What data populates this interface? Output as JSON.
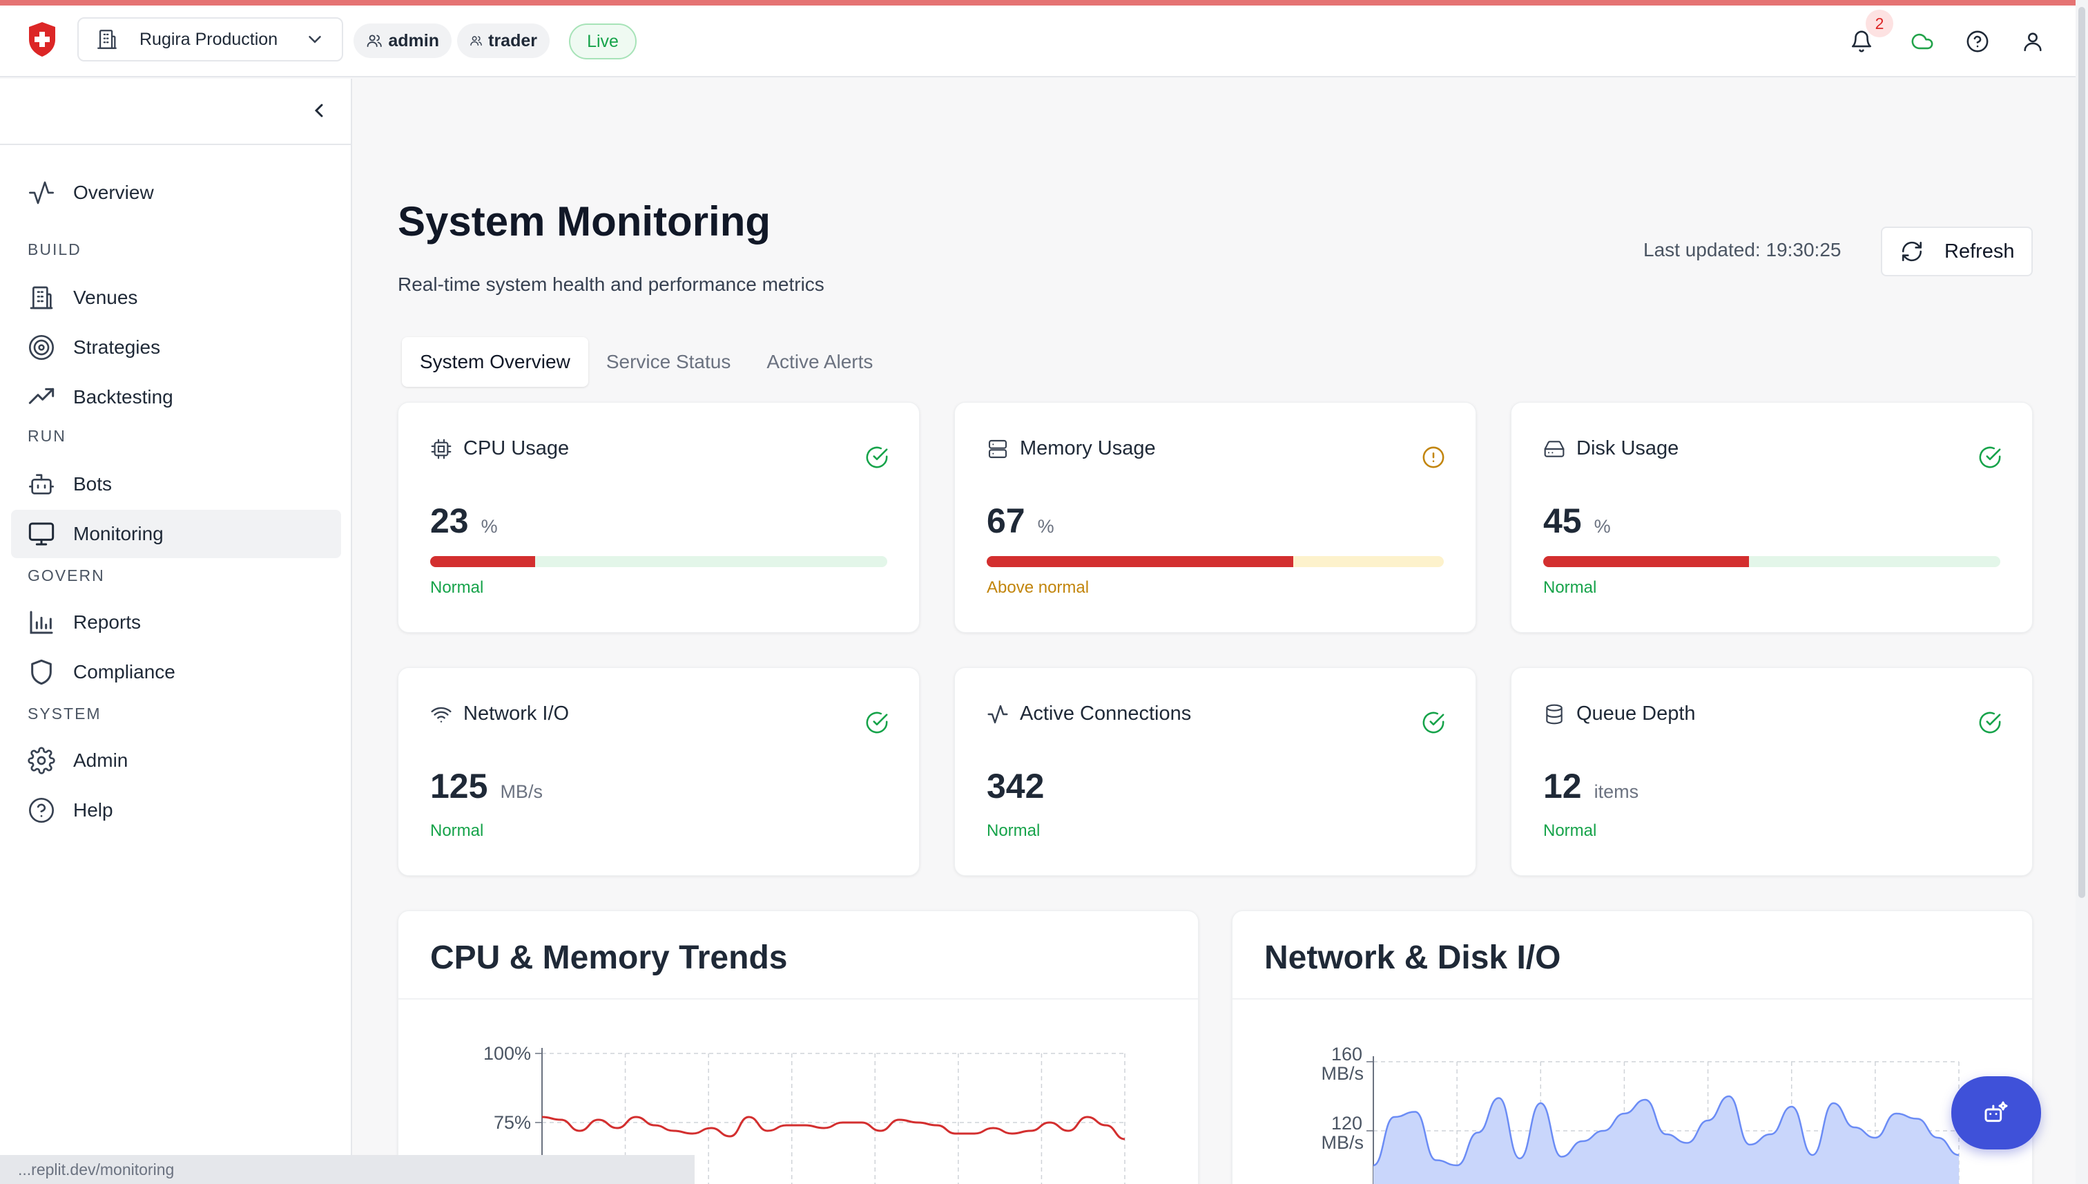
{
  "topbar": {
    "org_name": "Rugira Production",
    "roles": [
      "admin",
      "trader"
    ],
    "live_label": "Live",
    "notification_count": "2",
    "accent_color": "#e57373"
  },
  "sidebar": {
    "overview": "Overview",
    "sections": {
      "build": "BUILD",
      "run": "RUN",
      "govern": "GOVERN",
      "system": "SYSTEM"
    },
    "items": {
      "venues": "Venues",
      "strategies": "Strategies",
      "backtesting": "Backtesting",
      "bots": "Bots",
      "monitoring": "Monitoring",
      "reports": "Reports",
      "compliance": "Compliance",
      "admin": "Admin",
      "help": "Help"
    },
    "active_item": "Monitoring"
  },
  "page": {
    "title": "System Monitoring",
    "subtitle": "Real-time system health and performance metrics",
    "last_updated": "Last updated: 19:30:25",
    "refresh_label": "Refresh"
  },
  "tabs": [
    "System Overview",
    "Service Status",
    "Active Alerts"
  ],
  "metrics": [
    {
      "title": "CPU Usage",
      "value": "23",
      "unit": "%",
      "progress": 0.23,
      "status": "Normal",
      "icon": "cpu-icon",
      "state": "ok"
    },
    {
      "title": "Memory Usage",
      "value": "67",
      "unit": "%",
      "progress": 0.67,
      "status": "Above normal",
      "icon": "memory-icon",
      "state": "warning"
    },
    {
      "title": "Disk Usage",
      "value": "45",
      "unit": "%",
      "progress": 0.45,
      "status": "Normal",
      "icon": "disk-icon",
      "state": "ok"
    },
    {
      "title": "Network I/O",
      "value": "125",
      "unit": "MB/s",
      "status": "Normal",
      "icon": "wifi-icon",
      "state": "ok"
    },
    {
      "title": "Active Connections",
      "value": "342",
      "unit": "",
      "status": "Normal",
      "icon": "activity-icon",
      "state": "ok"
    },
    {
      "title": "Queue Depth",
      "value": "12",
      "unit": "items",
      "status": "Normal",
      "icon": "database-icon",
      "state": "ok"
    }
  ],
  "colors": {
    "ok": "#16a34a",
    "warning": "#c2850c",
    "bar_fill": "#d32f2f",
    "track_ok": "#e3f6e9",
    "track_warning": "#fdf2cc"
  },
  "charts": {
    "cpu_memory_title": "CPU & Memory Trends",
    "network_disk_title": "Network & Disk I/O"
  },
  "chart_data": [
    {
      "type": "line",
      "title": "CPU & Memory Trends",
      "y_ticks": [
        "100%",
        "75%"
      ],
      "series": [
        {
          "color": "#d32f2f",
          "values": [
            77,
            76,
            72,
            76,
            73,
            77,
            74,
            72,
            71,
            73,
            70,
            77,
            72,
            74,
            74,
            73,
            75,
            75,
            72,
            76,
            75,
            74,
            71,
            71,
            73,
            71,
            72,
            75,
            72,
            77,
            74,
            69
          ]
        }
      ]
    },
    {
      "type": "area",
      "title": "Network & Disk I/O",
      "y_ticks": [
        "160",
        "120"
      ],
      "y_unit": "MB/s",
      "series": [
        {
          "color": "#6b8cf5",
          "values": [
            100,
            128,
            131,
            103,
            100,
            119,
            139,
            104,
            136,
            105,
            114,
            120,
            130,
            138,
            118,
            113,
            126,
            140,
            112,
            118,
            134,
            106,
            136,
            122,
            116,
            130,
            127,
            116,
            106
          ]
        }
      ]
    }
  ],
  "status_bar": {
    "url": "...replit.dev/monitoring"
  },
  "icons": {
    "logo": "shield-cross-logo",
    "bell": "bell-icon",
    "cloud": "cloud-icon",
    "help": "help-circle-icon",
    "user": "user-icon",
    "fab": "ai-assistant-icon"
  }
}
